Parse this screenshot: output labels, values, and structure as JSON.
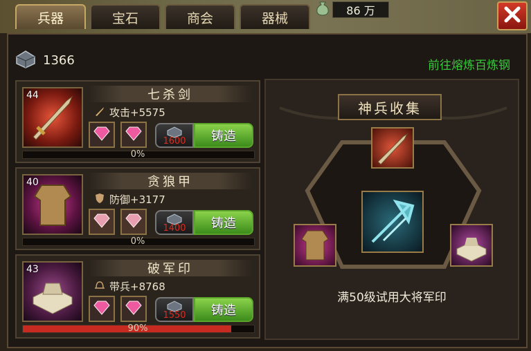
{
  "tabs": [
    {
      "label": "兵器",
      "active": true
    },
    {
      "label": "宝石",
      "active": false
    },
    {
      "label": "商会",
      "active": false
    },
    {
      "label": "器械",
      "active": false
    }
  ],
  "currency": {
    "value": "86 万"
  },
  "resource": {
    "count": "1366",
    "icon": "steel-ingot-icon"
  },
  "goto_link": "前往熔炼百炼钢",
  "forge_label": "铸造",
  "items": [
    {
      "level": "44",
      "name": "七杀剑",
      "stat": "攻击+5575",
      "stat_icon": "sword-icon",
      "cost": "1600",
      "progress_text": "0%",
      "progress": 0
    },
    {
      "level": "40",
      "name": "贪狼甲",
      "stat": "防御+3177",
      "stat_icon": "shield-icon",
      "cost": "1400",
      "progress_text": "0%",
      "progress": 0
    },
    {
      "level": "43",
      "name": "破军印",
      "stat": "带兵+8768",
      "stat_icon": "helmet-icon",
      "cost": "1550",
      "progress_text": "90%",
      "progress": 0.9
    }
  ],
  "collection": {
    "title": "神兵收集",
    "description": "满50级试用大将军印"
  },
  "colors": {
    "forge_button": "#5aa52a",
    "cost_red": "#e02a1c",
    "link_green": "#38c83c",
    "progress_red": "#c62a20"
  }
}
